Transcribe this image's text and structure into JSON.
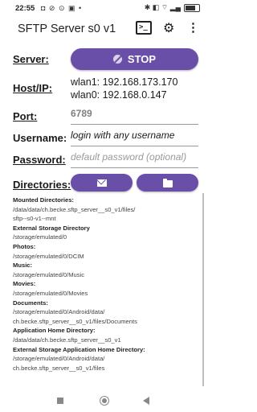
{
  "status_bar": {
    "time": "22:55",
    "icons_left": "◘ ⊘ ⊙ ▣ •",
    "icons_right": "✱ ◧ ⌔ ▂▄"
  },
  "app_bar": {
    "title": "SFTP Server s0 v1",
    "terminal_icon_text": ">_",
    "settings_icon": "⚙",
    "more_icon": "⋮"
  },
  "server": {
    "label": "Server:",
    "button_label": "STOP"
  },
  "host": {
    "label": "Host/IP:",
    "lines": [
      "wlan1: 192.168.173.170",
      "wlan0: 192.168.0.147"
    ]
  },
  "port": {
    "label": "Port:",
    "value": "6789"
  },
  "username": {
    "label": "Username:",
    "value": "login with any username"
  },
  "password": {
    "label": "Password:",
    "placeholder": "default password (optional)"
  },
  "directories": {
    "label": "Directories:",
    "entries": [
      {
        "heading": "Mounted Directories:",
        "paths": [
          "/data/data/ch.becke.sftp_server__s0_v1/files/",
          "sftp--s0-v1--mnt"
        ]
      },
      {
        "heading": "External Storage Directory",
        "paths": [
          "/storage/emulated/0"
        ]
      },
      {
        "heading": "Photos:",
        "paths": [
          "/storage/emulated/0/DCIM"
        ]
      },
      {
        "heading": "Music:",
        "paths": [
          "/storage/emulated/0/Music"
        ]
      },
      {
        "heading": "Movies:",
        "paths": [
          "/storage/emulated/0/Movies"
        ]
      },
      {
        "heading": "Documents:",
        "paths": [
          "/storage/emulated/0/Android/data/",
          "ch.becke.sftp_server__s0_v1/files/Documents"
        ]
      },
      {
        "heading": "Application Home Directory:",
        "paths": [
          "/data/data/ch.becke.sftp_server__s0_v1"
        ]
      },
      {
        "heading": "External Storage Application Home Directory:",
        "paths": [
          "/storage/emulated/0/Android/data/",
          "ch.becke.sftp_server__s0_v1/files"
        ]
      }
    ]
  },
  "colors": {
    "accent": "#6a4fa8"
  }
}
